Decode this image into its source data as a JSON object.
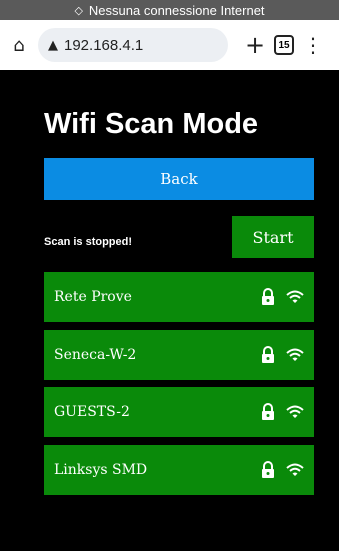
{
  "status_bar": {
    "text": "Nessuna connessione Internet",
    "icon": "no-signal-icon"
  },
  "browser": {
    "url": "192.168.4.1",
    "tab_count": "15",
    "home_icon": "home-icon",
    "warning_icon": "warning-icon",
    "new_tab_icon": "plus-icon",
    "menu_icon": "more-vertical-icon"
  },
  "page": {
    "title": "Wifi Scan Mode",
    "back_label": "Back",
    "scan_status": "Scan is stopped!",
    "start_label": "Start"
  },
  "networks": [
    {
      "name": "Rete Prove",
      "secured": true
    },
    {
      "name": "Seneca-W-2",
      "secured": true
    },
    {
      "name": "GUESTS-2",
      "secured": true
    },
    {
      "name": "Linksys SMD",
      "secured": true
    }
  ],
  "colors": {
    "back": "#0b8ce3",
    "green": "#0a8a0a",
    "background": "#000000"
  }
}
